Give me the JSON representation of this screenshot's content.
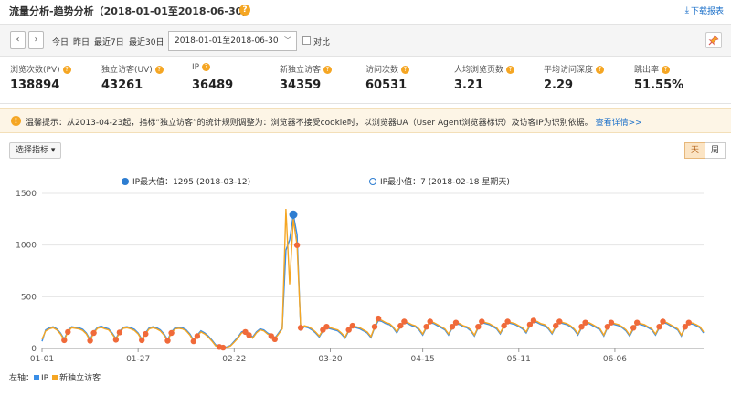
{
  "header": {
    "title": "流量分析-趋势分析（2018-01-01至2018-06-30）",
    "help_icon": "question-icon",
    "download_label": "下载报表"
  },
  "toolbar": {
    "prev_icon": "‹",
    "next_icon": "›",
    "today": "今日",
    "yesterday": "昨日",
    "last7": "最近7日",
    "last30": "最近30日",
    "date_range": "2018-01-01至2018-06-30",
    "compare_label": "对比"
  },
  "metrics": [
    {
      "label": "浏览次数(PV)",
      "value": "138894"
    },
    {
      "label": "独立访客(UV)",
      "value": "43261"
    },
    {
      "label": "IP",
      "value": "36489"
    },
    {
      "label": "新独立访客",
      "value": "34359"
    },
    {
      "label": "访问次数",
      "value": "60531"
    },
    {
      "label": "人均浏览页数",
      "value": "3.21"
    },
    {
      "label": "平均访问深度",
      "value": "2.29"
    },
    {
      "label": "跳出率",
      "value": "51.55%"
    }
  ],
  "notice": {
    "text": "温馨提示：从2013-04-23起，指标“独立访客”的统计规则调整为：浏览器不接受cookie时，以浏览器UA（User Agent浏览器标识）及访客IP为识别依据。",
    "link": "查看详情>>"
  },
  "controls": {
    "metric_select": "选择指标",
    "period_day": "天",
    "period_week": "周"
  },
  "legend": {
    "max": "IP最大值：1295 (2018-03-12)",
    "min": "IP最小值：7 (2018-02-18 星期天)"
  },
  "footer": {
    "axis_label": "左轴：",
    "series_ip": "IP",
    "series_new": "新独立访客"
  },
  "colors": {
    "ip": "#3a8ee6",
    "new_visitors": "#f5a623",
    "marker": "#f06a3a",
    "accent": "#f5a623",
    "link": "#1a6fc9"
  },
  "chart_data": {
    "type": "line",
    "ylim": [
      0,
      1500
    ],
    "yticks": [
      0,
      500,
      1000,
      1500
    ],
    "xtick_labels": [
      "01-01",
      "01-27",
      "02-22",
      "03-20",
      "04-15",
      "05-11",
      "06-06"
    ],
    "series": [
      {
        "name": "IP",
        "values": [
          70,
          180,
          200,
          210,
          190,
          150,
          90,
          170,
          210,
          205,
          200,
          185,
          150,
          85,
          160,
          205,
          215,
          200,
          190,
          150,
          95,
          165,
          205,
          210,
          200,
          185,
          150,
          90,
          150,
          200,
          210,
          200,
          180,
          140,
          85,
          160,
          200,
          205,
          200,
          180,
          140,
          80,
          130,
          170,
          150,
          120,
          80,
          35,
          20,
          10,
          15,
          30,
          70,
          110,
          160,
          170,
          140,
          110,
          160,
          190,
          180,
          150,
          130,
          100,
          150,
          200,
          950,
          1050,
          1295,
          1100,
          180,
          210,
          200,
          180,
          150,
          110,
          170,
          200,
          190,
          180,
          170,
          140,
          100,
          170,
          210,
          200,
          190,
          170,
          150,
          105,
          200,
          270,
          260,
          240,
          230,
          200,
          150,
          210,
          250,
          240,
          220,
          210,
          180,
          130,
          200,
          250,
          240,
          220,
          200,
          180,
          130,
          200,
          240,
          230,
          210,
          200,
          170,
          120,
          200,
          250,
          240,
          230,
          210,
          190,
          140,
          210,
          250,
          240,
          230,
          210,
          190,
          150,
          220,
          260,
          250,
          230,
          220,
          190,
          140,
          210,
          250,
          240,
          230,
          210,
          180,
          130,
          200,
          240,
          240,
          220,
          200,
          180,
          120,
          200,
          240,
          230,
          220,
          200,
          170,
          120,
          190,
          240,
          230,
          220,
          200,
          180,
          130,
          200,
          250,
          240,
          220,
          200,
          180,
          120,
          200,
          240,
          235,
          220,
          200,
          150
        ]
      },
      {
        "name": "新独立访客",
        "values": [
          90,
          170,
          190,
          200,
          180,
          140,
          80,
          160,
          200,
          195,
          190,
          175,
          140,
          75,
          150,
          195,
          205,
          190,
          180,
          140,
          85,
          155,
          195,
          200,
          190,
          175,
          140,
          80,
          140,
          190,
          200,
          190,
          170,
          130,
          75,
          150,
          190,
          195,
          190,
          170,
          130,
          70,
          120,
          160,
          140,
          110,
          70,
          25,
          15,
          8,
          10,
          25,
          60,
          100,
          150,
          160,
          130,
          100,
          150,
          180,
          170,
          140,
          120,
          90,
          140,
          190,
          1350,
          620,
          1250,
          1000,
          200,
          220,
          210,
          190,
          160,
          120,
          180,
          210,
          200,
          190,
          180,
          150,
          110,
          180,
          220,
          210,
          200,
          180,
          160,
          115,
          210,
          290,
          270,
          250,
          240,
          210,
          160,
          220,
          260,
          250,
          230,
          220,
          190,
          140,
          210,
          260,
          250,
          230,
          210,
          190,
          140,
          210,
          250,
          240,
          220,
          210,
          180,
          130,
          210,
          260,
          250,
          240,
          220,
          200,
          150,
          220,
          260,
          250,
          240,
          220,
          200,
          160,
          230,
          270,
          260,
          240,
          230,
          200,
          150,
          220,
          260,
          250,
          240,
          220,
          190,
          140,
          210,
          250,
          250,
          230,
          210,
          190,
          130,
          210,
          250,
          240,
          230,
          210,
          180,
          130,
          200,
          250,
          240,
          230,
          210,
          190,
          140,
          210,
          260,
          250,
          230,
          210,
          190,
          130,
          210,
          250,
          245,
          230,
          210,
          160
        ]
      }
    ],
    "highlight_max": {
      "date": "2018-03-12",
      "value": 1295
    },
    "highlight_min": {
      "date": "2018-02-18",
      "value": 7
    }
  }
}
